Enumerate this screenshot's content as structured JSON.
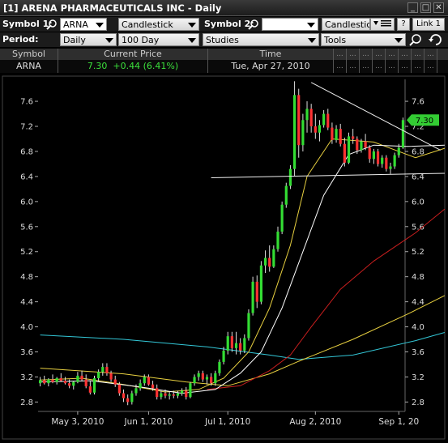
{
  "window": {
    "title": "[1] ARENA PHARMACEUTICALS INC - Daily",
    "minimize_glyph": "_",
    "restore_glyph": "□",
    "close_glyph": "✕"
  },
  "toolbar1": {
    "symbol1_label": "Symbol 1:",
    "symbol1_value": "ARNA",
    "chart_type": "Candlestick",
    "symbol2_label": "Symbol 2:",
    "symbol2_value": "",
    "chart_type2": "Candlestick",
    "help_label": "?",
    "link_label": "Link 1"
  },
  "toolbar2": {
    "period_label": "Period:",
    "period_value": "Daily",
    "range_value": "100 Day",
    "studies_value": "Studies",
    "tools_value": "Tools"
  },
  "quote": {
    "headers": [
      "Symbol",
      "Current Price",
      "Time"
    ],
    "symbol": "ARNA",
    "price": "7.30",
    "change": "+0.44 (6.41%)",
    "time": "Tue, Apr 27, 2010",
    "extra_cell": "..."
  },
  "colors": {
    "up": "#33dd33",
    "down": "#ff3333",
    "ma_cyan": "#33c8d8",
    "ma_yellow": "#e8d040",
    "ma_red": "#c81e1e",
    "ma_white": "#ffffff",
    "price_tag": "#33cc33"
  },
  "chart_data": {
    "type": "candlestick",
    "price_tag": "7.30",
    "y_ticks": [
      "2.8",
      "3.2",
      "3.6",
      "4.0",
      "4.4",
      "4.8",
      "5.2",
      "5.6",
      "6.0",
      "6.4",
      "6.8",
      "7.2",
      "7.6"
    ],
    "ylim": [
      2.65,
      7.95
    ],
    "x_ticks": [
      "May 3, 2010",
      "Jun 1, 2010",
      "Jul 1, 2010",
      "Aug 2, 2010",
      "Sep 1, 20"
    ],
    "candles": [
      {
        "o": 3.1,
        "h": 3.2,
        "l": 3.05,
        "c": 3.15
      },
      {
        "o": 3.15,
        "h": 3.22,
        "l": 3.08,
        "c": 3.1
      },
      {
        "o": 3.1,
        "h": 3.18,
        "l": 3.05,
        "c": 3.16
      },
      {
        "o": 3.16,
        "h": 3.24,
        "l": 3.1,
        "c": 3.12
      },
      {
        "o": 3.12,
        "h": 3.2,
        "l": 3.08,
        "c": 3.18
      },
      {
        "o": 3.18,
        "h": 3.26,
        "l": 3.12,
        "c": 3.14
      },
      {
        "o": 3.14,
        "h": 3.2,
        "l": 3.08,
        "c": 3.1
      },
      {
        "o": 3.1,
        "h": 3.16,
        "l": 3.02,
        "c": 3.06
      },
      {
        "o": 3.06,
        "h": 3.14,
        "l": 3.0,
        "c": 3.12
      },
      {
        "o": 3.12,
        "h": 3.28,
        "l": 3.1,
        "c": 3.22
      },
      {
        "o": 3.22,
        "h": 3.3,
        "l": 3.14,
        "c": 3.16
      },
      {
        "o": 3.16,
        "h": 3.24,
        "l": 3.02,
        "c": 3.05
      },
      {
        "o": 3.05,
        "h": 3.14,
        "l": 2.92,
        "c": 2.95
      },
      {
        "o": 2.95,
        "h": 3.22,
        "l": 2.92,
        "c": 3.18
      },
      {
        "o": 3.18,
        "h": 3.32,
        "l": 3.12,
        "c": 3.28
      },
      {
        "o": 3.28,
        "h": 3.42,
        "l": 3.22,
        "c": 3.36
      },
      {
        "o": 3.36,
        "h": 3.42,
        "l": 3.22,
        "c": 3.26
      },
      {
        "o": 3.26,
        "h": 3.3,
        "l": 3.12,
        "c": 3.16
      },
      {
        "o": 3.16,
        "h": 3.22,
        "l": 3.04,
        "c": 3.08
      },
      {
        "o": 3.08,
        "h": 3.12,
        "l": 2.9,
        "c": 2.94
      },
      {
        "o": 2.94,
        "h": 3.0,
        "l": 2.8,
        "c": 2.86
      },
      {
        "o": 2.86,
        "h": 2.92,
        "l": 2.75,
        "c": 2.8
      },
      {
        "o": 2.8,
        "h": 2.98,
        "l": 2.76,
        "c": 2.94
      },
      {
        "o": 2.94,
        "h": 3.08,
        "l": 2.9,
        "c": 3.02
      },
      {
        "o": 3.02,
        "h": 3.16,
        "l": 2.98,
        "c": 3.1
      },
      {
        "o": 3.1,
        "h": 3.24,
        "l": 3.06,
        "c": 3.2
      },
      {
        "o": 3.2,
        "h": 3.24,
        "l": 3.06,
        "c": 3.08
      },
      {
        "o": 3.08,
        "h": 3.14,
        "l": 2.98,
        "c": 3.02
      },
      {
        "o": 3.02,
        "h": 3.08,
        "l": 2.84,
        "c": 2.88
      },
      {
        "o": 2.88,
        "h": 2.98,
        "l": 2.84,
        "c": 2.94
      },
      {
        "o": 2.94,
        "h": 3.0,
        "l": 2.86,
        "c": 2.9
      },
      {
        "o": 2.9,
        "h": 2.96,
        "l": 2.84,
        "c": 2.92
      },
      {
        "o": 2.92,
        "h": 2.98,
        "l": 2.86,
        "c": 2.9
      },
      {
        "o": 2.9,
        "h": 2.98,
        "l": 2.86,
        "c": 2.94
      },
      {
        "o": 2.94,
        "h": 3.02,
        "l": 2.9,
        "c": 2.98
      },
      {
        "o": 2.98,
        "h": 3.04,
        "l": 2.84,
        "c": 2.88
      },
      {
        "o": 2.88,
        "h": 3.12,
        "l": 2.86,
        "c": 3.1
      },
      {
        "o": 3.1,
        "h": 3.24,
        "l": 3.06,
        "c": 3.2
      },
      {
        "o": 3.2,
        "h": 3.3,
        "l": 3.14,
        "c": 3.26
      },
      {
        "o": 3.26,
        "h": 3.3,
        "l": 3.12,
        "c": 3.16
      },
      {
        "o": 3.16,
        "h": 3.24,
        "l": 3.08,
        "c": 3.2
      },
      {
        "o": 3.2,
        "h": 3.26,
        "l": 3.06,
        "c": 3.1
      },
      {
        "o": 3.1,
        "h": 3.3,
        "l": 3.06,
        "c": 3.26
      },
      {
        "o": 3.26,
        "h": 3.48,
        "l": 3.22,
        "c": 3.44
      },
      {
        "o": 3.44,
        "h": 3.68,
        "l": 3.4,
        "c": 3.62
      },
      {
        "o": 3.62,
        "h": 3.92,
        "l": 3.56,
        "c": 3.85
      },
      {
        "o": 3.85,
        "h": 3.92,
        "l": 3.6,
        "c": 3.66
      },
      {
        "o": 3.66,
        "h": 3.92,
        "l": 3.56,
        "c": 3.74
      },
      {
        "o": 3.74,
        "h": 3.82,
        "l": 3.56,
        "c": 3.62
      },
      {
        "o": 3.62,
        "h": 3.88,
        "l": 3.58,
        "c": 3.82
      },
      {
        "o": 3.82,
        "h": 4.28,
        "l": 3.78,
        "c": 4.22
      },
      {
        "o": 4.22,
        "h": 4.8,
        "l": 4.18,
        "c": 4.72
      },
      {
        "o": 4.72,
        "h": 4.82,
        "l": 4.3,
        "c": 4.4
      },
      {
        "o": 4.4,
        "h": 5.05,
        "l": 4.36,
        "c": 4.98
      },
      {
        "o": 4.98,
        "h": 5.22,
        "l": 4.86,
        "c": 5.1
      },
      {
        "o": 5.1,
        "h": 5.3,
        "l": 4.88,
        "c": 4.96
      },
      {
        "o": 4.96,
        "h": 5.3,
        "l": 4.94,
        "c": 5.24
      },
      {
        "o": 5.24,
        "h": 5.6,
        "l": 5.2,
        "c": 5.52
      },
      {
        "o": 5.52,
        "h": 6.0,
        "l": 5.48,
        "c": 5.95
      },
      {
        "o": 5.95,
        "h": 6.3,
        "l": 5.9,
        "c": 6.25
      },
      {
        "o": 6.25,
        "h": 6.58,
        "l": 6.2,
        "c": 6.52
      },
      {
        "o": 6.52,
        "h": 7.92,
        "l": 6.4,
        "c": 7.7
      },
      {
        "o": 7.7,
        "h": 7.8,
        "l": 6.7,
        "c": 6.9
      },
      {
        "o": 6.9,
        "h": 7.4,
        "l": 6.8,
        "c": 7.3
      },
      {
        "o": 7.3,
        "h": 7.6,
        "l": 7.1,
        "c": 7.48
      },
      {
        "o": 7.48,
        "h": 7.56,
        "l": 7.1,
        "c": 7.2
      },
      {
        "o": 7.2,
        "h": 7.4,
        "l": 7.0,
        "c": 7.1
      },
      {
        "o": 7.1,
        "h": 7.3,
        "l": 6.96,
        "c": 7.22
      },
      {
        "o": 7.22,
        "h": 7.46,
        "l": 7.18,
        "c": 7.4
      },
      {
        "o": 7.4,
        "h": 7.48,
        "l": 7.14,
        "c": 7.18
      },
      {
        "o": 7.18,
        "h": 7.26,
        "l": 6.92,
        "c": 6.98
      },
      {
        "o": 6.98,
        "h": 7.22,
        "l": 6.94,
        "c": 7.16
      },
      {
        "o": 7.16,
        "h": 7.24,
        "l": 6.88,
        "c": 6.92
      },
      {
        "o": 6.92,
        "h": 7.02,
        "l": 6.56,
        "c": 6.62
      },
      {
        "o": 6.62,
        "h": 7.1,
        "l": 6.6,
        "c": 7.04
      },
      {
        "o": 7.04,
        "h": 7.16,
        "l": 6.92,
        "c": 7.0
      },
      {
        "o": 7.0,
        "h": 7.04,
        "l": 6.76,
        "c": 6.82
      },
      {
        "o": 6.82,
        "h": 7.0,
        "l": 6.78,
        "c": 6.96
      },
      {
        "o": 6.96,
        "h": 7.08,
        "l": 6.82,
        "c": 6.86
      },
      {
        "o": 6.86,
        "h": 6.9,
        "l": 6.62,
        "c": 6.68
      },
      {
        "o": 6.68,
        "h": 6.84,
        "l": 6.6,
        "c": 6.8
      },
      {
        "o": 6.8,
        "h": 6.84,
        "l": 6.56,
        "c": 6.6
      },
      {
        "o": 6.6,
        "h": 6.74,
        "l": 6.54,
        "c": 6.7
      },
      {
        "o": 6.7,
        "h": 6.74,
        "l": 6.48,
        "c": 6.52
      },
      {
        "o": 6.52,
        "h": 6.62,
        "l": 6.44,
        "c": 6.56
      },
      {
        "o": 6.56,
        "h": 6.78,
        "l": 6.52,
        "c": 6.74
      },
      {
        "o": 6.74,
        "h": 6.92,
        "l": 6.7,
        "c": 6.86
      },
      {
        "o": 6.86,
        "h": 7.34,
        "l": 6.84,
        "c": 7.3
      }
    ],
    "moving_averages": [
      {
        "name": "MA cyan",
        "color": "#33c8d8",
        "points": [
          [
            0,
            3.87
          ],
          [
            20,
            3.8
          ],
          [
            40,
            3.68
          ],
          [
            55,
            3.55
          ],
          [
            62,
            3.48
          ],
          [
            75,
            3.55
          ],
          [
            90,
            3.78
          ],
          [
            97,
            3.91
          ]
        ]
      },
      {
        "name": "MA yellow",
        "color": "#e8d040",
        "points": [
          [
            0,
            3.34
          ],
          [
            20,
            3.25
          ],
          [
            35,
            3.12
          ],
          [
            45,
            3.06
          ],
          [
            55,
            3.25
          ],
          [
            62,
            3.45
          ],
          [
            75,
            3.8
          ],
          [
            88,
            4.2
          ],
          [
            97,
            4.5
          ]
        ]
      },
      {
        "name": "MA red",
        "color": "#c81e1e",
        "points": [
          [
            40,
            3.0
          ],
          [
            48,
            3.06
          ],
          [
            55,
            3.3
          ],
          [
            60,
            3.55
          ],
          [
            65,
            4.0
          ],
          [
            72,
            4.6
          ],
          [
            80,
            5.05
          ],
          [
            90,
            5.5
          ],
          [
            97,
            5.88
          ]
        ]
      },
      {
        "name": "MA thin yellow",
        "color": "#e8d040",
        "points": [
          [
            0,
            3.15
          ],
          [
            10,
            3.18
          ],
          [
            20,
            3.08
          ],
          [
            30,
            2.96
          ],
          [
            38,
            3.0
          ],
          [
            44,
            3.18
          ],
          [
            50,
            3.6
          ],
          [
            55,
            4.3
          ],
          [
            60,
            5.3
          ],
          [
            64,
            6.4
          ],
          [
            70,
            7.0
          ],
          [
            80,
            6.95
          ],
          [
            90,
            6.7
          ],
          [
            97,
            6.85
          ]
        ]
      },
      {
        "name": "MA white",
        "color": "#ffffff",
        "points": [
          [
            0,
            3.12
          ],
          [
            12,
            3.14
          ],
          [
            24,
            3.04
          ],
          [
            34,
            2.94
          ],
          [
            42,
            3.0
          ],
          [
            48,
            3.26
          ],
          [
            53,
            3.6
          ],
          [
            58,
            4.3
          ],
          [
            63,
            5.2
          ],
          [
            68,
            6.1
          ],
          [
            74,
            6.75
          ],
          [
            80,
            6.9
          ],
          [
            88,
            6.88
          ],
          [
            97,
            6.9
          ]
        ]
      }
    ],
    "trendlines": [
      {
        "x1": 65,
        "y1": 7.9,
        "x2": 96,
        "y2": 6.82
      },
      {
        "x1": 41,
        "y1": 6.38,
        "x2": 97,
        "y2": 6.45
      }
    ],
    "x_tick_index": [
      9,
      26,
      45,
      66,
      86
    ]
  }
}
